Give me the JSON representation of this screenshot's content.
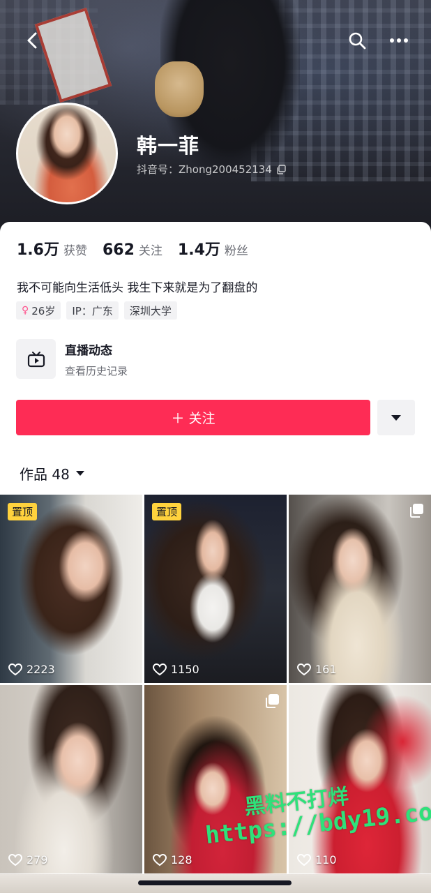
{
  "header": {
    "name": "韩一菲",
    "douyin_id": "抖音号：Zhong200452134"
  },
  "stats": [
    {
      "value": "1.6万",
      "label": "获赞"
    },
    {
      "value": "662",
      "label": "关注"
    },
    {
      "value": "1.4万",
      "label": "粉丝"
    }
  ],
  "bio": "我不可能向生活低头 我生下来就是为了翻盘的",
  "tags": {
    "age": "26岁",
    "ip": "IP：广东",
    "school": "深圳大学"
  },
  "live": {
    "title": "直播动态",
    "subtitle": "查看历史记录"
  },
  "follow_label": "＋ 关注",
  "works_tab": "作品 48",
  "pin_label": "置顶",
  "grid": [
    {
      "likes": "2223"
    },
    {
      "likes": "1150"
    },
    {
      "likes": "161"
    },
    {
      "likes": "279"
    },
    {
      "likes": "128"
    },
    {
      "likes": "110"
    }
  ],
  "watermark": {
    "line1": "黑料不打烊",
    "line2": "https://bdy19.co"
  },
  "colors": {
    "accent": "#fe2c55",
    "pin": "#ffd23d",
    "watermark": "#2fe17a"
  }
}
